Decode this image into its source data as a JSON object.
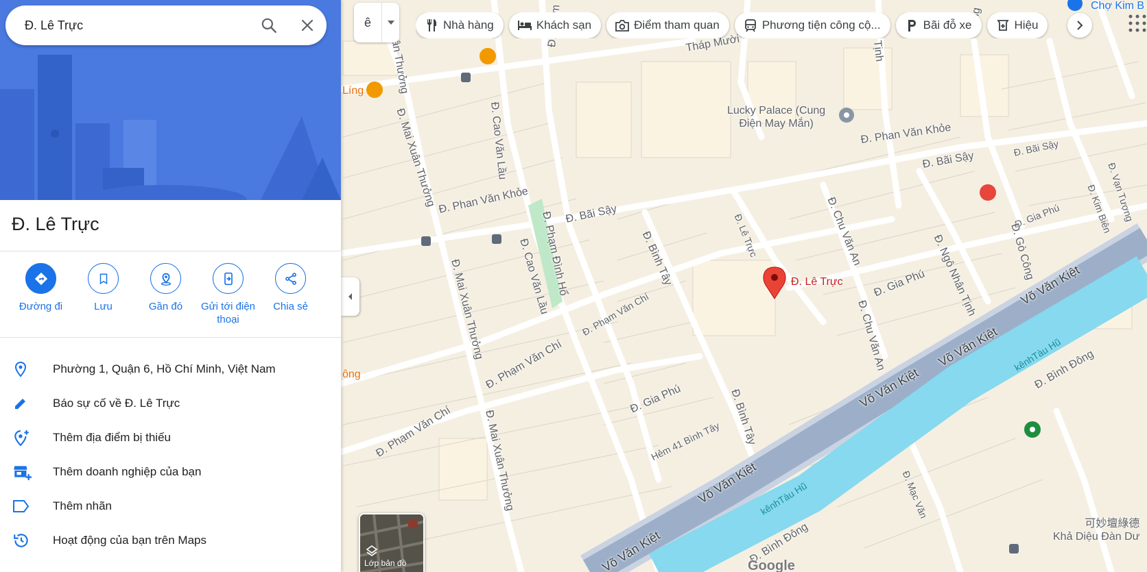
{
  "search": {
    "query": "Đ. Lê Trực"
  },
  "place": {
    "title": "Đ. Lê Trực"
  },
  "actions": [
    {
      "label": "Đường đi",
      "icon": "directions-icon"
    },
    {
      "label": "Lưu",
      "icon": "bookmark-icon"
    },
    {
      "label": "Gần đó",
      "icon": "nearby-icon"
    },
    {
      "label": "Gửi tới điện thoại",
      "icon": "send-to-phone-icon"
    },
    {
      "label": "Chia sẻ",
      "icon": "share-icon"
    }
  ],
  "info": [
    {
      "text": "Phường 1, Quận 6, Hồ Chí Minh, Việt Nam",
      "icon": "location-pin-icon"
    },
    {
      "text": "Báo sự cố về Đ. Lê Trực",
      "icon": "edit-pencil-icon"
    },
    {
      "text": "Thêm địa điểm bị thiếu",
      "icon": "add-place-icon"
    },
    {
      "text": "Thêm doanh nghiệp của bạn",
      "icon": "add-business-icon"
    },
    {
      "text": "Thêm nhãn",
      "icon": "label-icon"
    },
    {
      "text": "Hoạt động của bạn trên Maps",
      "icon": "history-icon"
    }
  ],
  "lang_button": {
    "label": "ê"
  },
  "chips": [
    {
      "label": "Nhà hàng",
      "icon": "restaurant-icon"
    },
    {
      "label": "Khách sạn",
      "icon": "hotel-icon"
    },
    {
      "label": "Điểm tham quan",
      "icon": "camera-icon"
    },
    {
      "label": "Phương tiện công cộ...",
      "icon": "transit-icon"
    },
    {
      "label": "Bãi đỗ xe",
      "icon": "parking-icon"
    },
    {
      "label": "Hiệu",
      "icon": "pharmacy-icon"
    }
  ],
  "layers": {
    "label": "Lớp bản đồ"
  },
  "map": {
    "pin_label": "Đ. Lê Trực",
    "labels": {
      "thap_muoi": "Tháp Mười",
      "lucky_palace": "Lucky Palace (Cung\nĐiện May Mắn)",
      "phan_van_khoe_1": "Đ. Phan Văn Khỏe",
      "phan_van_khoe_2": "Đ. Phan Văn Khỏe",
      "bai_say_1": "Đ. Bãi Sậy",
      "bai_say_2": "Đ. Bãi Sậy",
      "bai_say_3": "Đ. Bãi Sậy",
      "mai_xuan_thuong_1": "Đ. Mai Xuân Thưởng",
      "mai_xuan_thuong_2": "Đ. Mai Xuân Thưởng",
      "mai_xuan_thuong_3": "Đ. Mai Xuân Thưởng",
      "cao_van_lau_1": "Đ. Cao Văn Lầu",
      "cao_van_lau_2": "Đ. Cao Văn Lầu",
      "pham_dinh_ho_1": "Đ. Phạm Đình Hổ",
      "pham_dinh_ho_2": "Đ. Phạm",
      "binh_tay_1": "Đ. Bình Tây",
      "binh_tay_2": "Đ. Bình Tây",
      "le_truc_small": "Đ. Lê Trực",
      "chu_van_an_1": "Đ. Chu Văn An",
      "chu_van_an_2": "Đ. Chu Văn An",
      "gia_phu_1": "Đ. Gia Phú",
      "gia_phu_2": "Đ. Gia Phú",
      "gia_phu_3": "Đ. Gia Phú",
      "ngo_nhan_tinh": "Đ. Ngô Nhân Tịnh",
      "go_cong_1": "Đ. Gò Công",
      "go_cong_2": "Công",
      "kim_bien": "Đ. Kim Biên",
      "van_tuong": "Đ. Vạn Tượng",
      "pham_van_chi_1": "Đ. Phạm Văn Chí",
      "pham_van_chi_2": "Đ. Phạm Văn Chí",
      "pham_van_chi_3": "Đ. Phạm Văn Chí",
      "vo_van_kiet_1": "Võ Văn Kiệt",
      "vo_van_kiet_2": "Võ Văn Kiệt",
      "vo_van_kiet_3": "Võ Văn Kiệt",
      "vo_van_kiet_4": "Võ Văn Kiệt",
      "vo_van_kiet_5": "Võ Văn Kiệt",
      "kenh_tau_hu_1": "kênhTàu Hũ",
      "kenh_tau_hu_2": "kênhTàu Hũ",
      "binh_dong_1": "Đ. Bình Đông",
      "binh_dong_2": "Đ. Bình Đông",
      "hem_41": "Hẻm 41 Bình Tây",
      "mac_van": "Đ. Mạc Văn",
      "cho_kim_bien": "Chợ Kim B",
      "kha_dieu": "可妙壇綠德\nKhả Diệu Đàn Dư",
      "ling": "Líng",
      "ong": "ông",
      "tinh": "Tịnh",
      "xuan_thuong_top": "Xuân Thưởng",
      "google": "Google"
    }
  },
  "colors": {
    "accent": "#1a73e8",
    "hero": "#4a79e0",
    "pin": "#ea4335",
    "water": "#86d9ee",
    "highway": "#8fa3bf",
    "road": "#ffffff",
    "block": "#fbf3e2"
  }
}
